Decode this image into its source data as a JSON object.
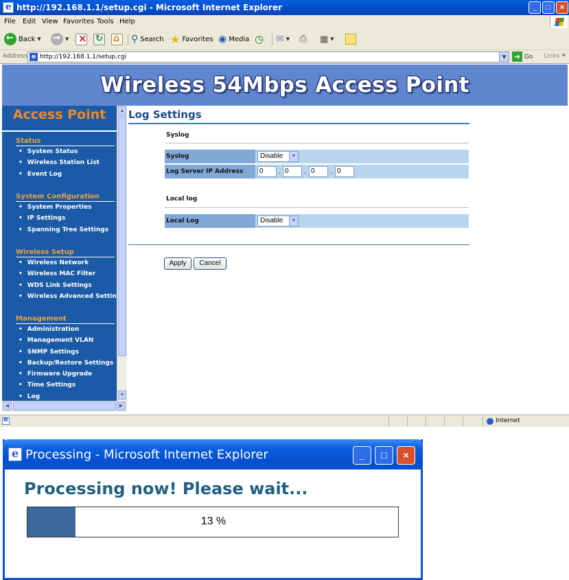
{
  "window": {
    "title": "http://192.168.1.1/setup.cgi - Microsoft Internet Explorer",
    "min": "_",
    "max": "□",
    "close": "×"
  },
  "menu": [
    "File",
    "Edit",
    "View",
    "Favorites",
    "Tools",
    "Help"
  ],
  "toolbar": {
    "back": "Back",
    "search": "Search",
    "favorites": "Favorites",
    "media": "Media"
  },
  "address": {
    "label": "Address",
    "url": "http://192.168.1.1/setup.cgi",
    "go": "Go",
    "links": "Links",
    "links_chevron": "»"
  },
  "banner": {
    "title": "Wireless 54Mbps Access Point"
  },
  "sidebar": {
    "title": "Access Point",
    "groups": [
      {
        "heading": "Status",
        "items": [
          "System Status",
          "Wireless Station List",
          "Event Log"
        ]
      },
      {
        "heading": "System Configuration",
        "items": [
          "System Properties",
          "IP Settings",
          "Spanning Tree Settings"
        ]
      },
      {
        "heading": "Wireless Setup",
        "items": [
          "Wireless Network",
          "Wireless MAC Filter",
          "WDS Link Settings",
          "Wireless Advanced Settings"
        ]
      },
      {
        "heading": "Management",
        "items": [
          "Administration",
          "Management VLAN",
          "SNMP Settings",
          "Backup/Restore Settings",
          "Firmware Upgrade",
          "Time Settings",
          "Log"
        ]
      }
    ]
  },
  "content": {
    "title": "Log Settings",
    "syslog_section": "Syslog",
    "syslog_label": "Syslog",
    "syslog_value": "Disable",
    "server_label": "Log Server IP Address",
    "ip": [
      "0",
      "0",
      "0",
      "0"
    ],
    "ip_separator": ".",
    "locallog_section": "Local log",
    "locallog_label": "Local Log",
    "locallog_value": "Disable",
    "apply": "Apply",
    "cancel": "Cancel"
  },
  "status": {
    "zone": "Internet"
  },
  "dialog": {
    "title": "Processing - Microsoft Internet Explorer",
    "message": "Processing now! Please wait...",
    "progress_percent": 13,
    "progress_text": "13 %"
  },
  "colors": {
    "banner": "#6086cf",
    "sidebar": "#1b5aa6",
    "sidebar_title": "#f08a24",
    "row_label": "#7fa8d6",
    "row": "#b7d5ee",
    "progress_fill": "#3d6a9e",
    "dialog_message": "#1f6080"
  },
  "icons": [
    "ie-logo-icon",
    "back-icon",
    "forward-icon",
    "stop-icon",
    "refresh-icon",
    "home-icon",
    "search-icon",
    "favorites-star-icon",
    "media-icon",
    "history-icon",
    "mail-icon",
    "print-icon",
    "edit-icon",
    "messenger-icon",
    "go-arrow-icon",
    "internet-zone-icon"
  ]
}
